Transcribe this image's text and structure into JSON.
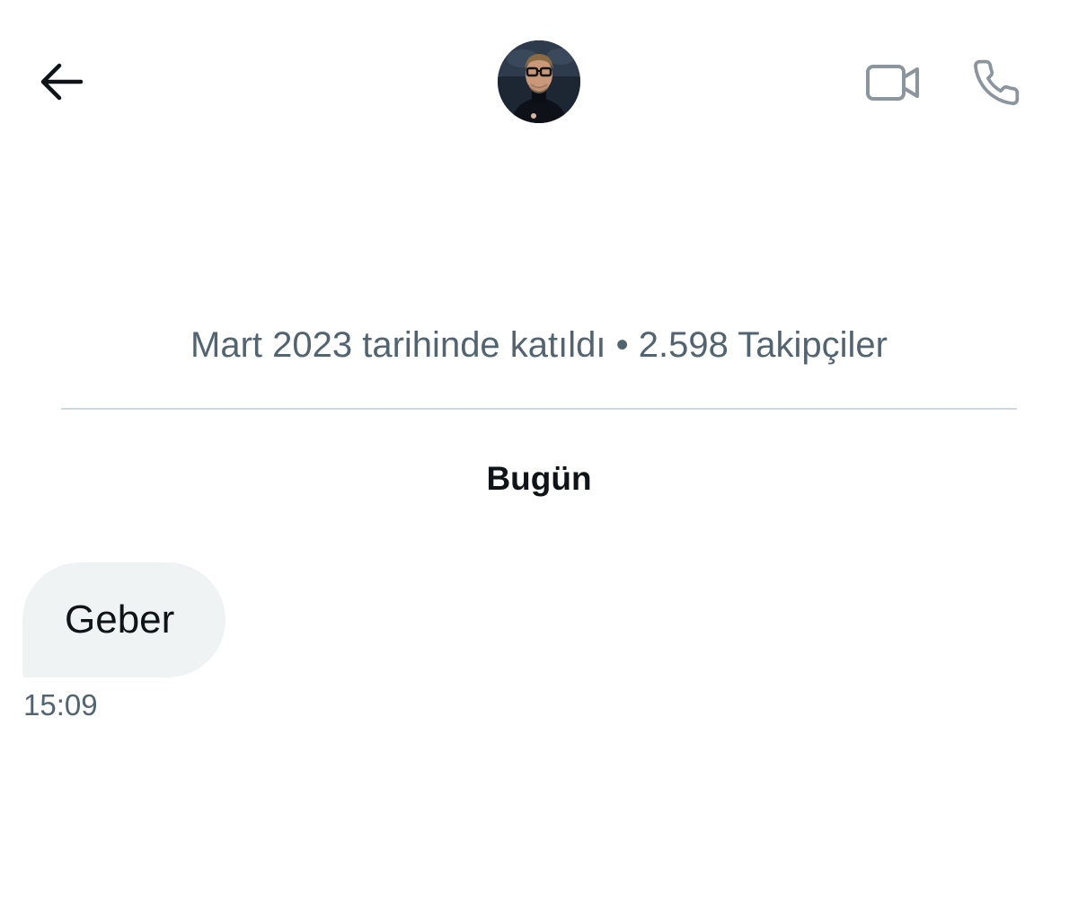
{
  "header": {
    "back_icon": "arrow-left-icon",
    "avatar_icon": "profile-photo",
    "video_icon": "video-camera-icon",
    "phone_icon": "phone-icon"
  },
  "profile": {
    "joined_and_followers": "Mart 2023 tarihinde katıldı • 2.598 Takipçiler"
  },
  "conversation": {
    "day_label": "Bugün",
    "messages": [
      {
        "text": "Geber",
        "time": "15:09",
        "direction": "incoming"
      }
    ]
  },
  "colors": {
    "text_primary": "#0f1419",
    "text_secondary": "#536471",
    "divider": "#cfd9de",
    "bubble_incoming": "#eff3f4",
    "icon_gray": "#8b959e"
  }
}
